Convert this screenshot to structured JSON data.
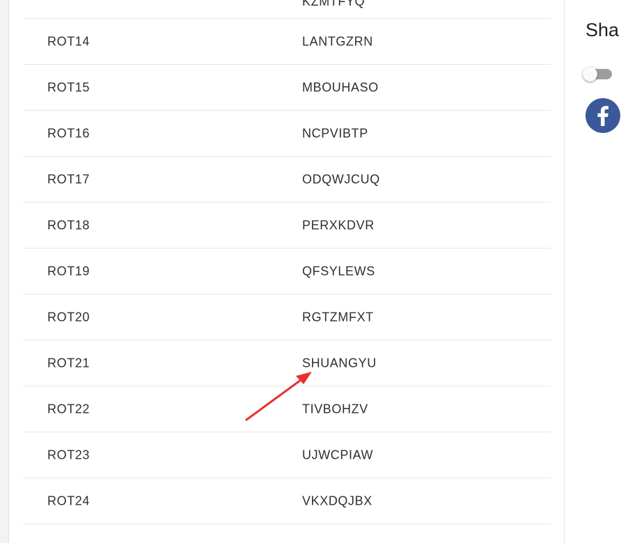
{
  "table": {
    "rows": [
      {
        "key": "",
        "value": "KZMTFYQ"
      },
      {
        "key": "ROT14",
        "value": "LANTGZRN"
      },
      {
        "key": "ROT15",
        "value": "MBOUHASO"
      },
      {
        "key": "ROT16",
        "value": "NCPVIBTP"
      },
      {
        "key": "ROT17",
        "value": "ODQWJCUQ"
      },
      {
        "key": "ROT18",
        "value": "PERXKDVR"
      },
      {
        "key": "ROT19",
        "value": "QFSYLEWS"
      },
      {
        "key": "ROT20",
        "value": "RGTZMFXT"
      },
      {
        "key": "ROT21",
        "value": "SHUANGYU"
      },
      {
        "key": "ROT22",
        "value": "TIVBOHZV"
      },
      {
        "key": "ROT23",
        "value": "UJWCPIAW"
      },
      {
        "key": "ROT24",
        "value": "VKXDQJBX"
      }
    ]
  },
  "sidebar": {
    "share_title": "Sha",
    "toggle_on": false,
    "facebook_icon": "facebook-icon",
    "facebook_color": "#3b5998"
  },
  "annotation": {
    "arrow_color": "#e8302f",
    "icon": "red-arrow-annotation"
  }
}
